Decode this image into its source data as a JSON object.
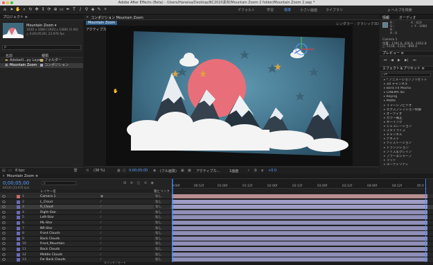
{
  "window": {
    "title": "Adobe After Effects (Beta) - /Users/Haneisa/Desktop/BC2020素材/Mountain Zoom 2 folder/Mountain Zoom 2.aep *"
  },
  "workspaces": [
    "デフォルト",
    "学習",
    "標準",
    "小さい画面",
    "ライブラリ"
  ],
  "workspace_active_index": 2,
  "project": {
    "header": "プロジェクト ≡",
    "comp_name": "Mountain Zoom ▾",
    "comp_info": [
      "1920 x 1080 (1920 x 1080) (1.00)",
      "△ 0;00;05;00, 23.976 fps"
    ],
    "search_placeholder": "ρ",
    "col_name": "名前",
    "col_type": "種類",
    "items": [
      {
        "name": "Adobeill...py Layers",
        "type": "フォルダー"
      },
      {
        "name": "Mountain Zoom",
        "type": "コンポジション"
      }
    ],
    "footer_bpc": "8 bpc"
  },
  "comp_panel": {
    "tab_label": "コンポジション Mountain Zoom",
    "subtab": "Mountain Zoom",
    "active_camera": "アクティブカメラ",
    "renderer": "レンダラー : クラシック3D",
    "footer": {
      "zoom": "(38 %)",
      "timecode": "0;00;05;00",
      "quality": "(フル画質)",
      "camera": "アクティブカ...",
      "views": "1画面",
      "exposure": "+0.0"
    }
  },
  "info_panel": {
    "tab_info": "情報",
    "tab_audio": "オーディオ",
    "values": [
      "R :",
      "G :",
      "B :",
      "A : 0",
      "X : 423",
      "+ Y : 1084"
    ],
    "lines": [
      "Camera 1",
      "位置：1291.6, 426.6, -1652.8",
      "△ -1156, -1122, -894.0"
    ]
  },
  "preview_panel": {
    "title": "プレビュー ≡"
  },
  "effects_panel": {
    "title": "エフェクト＆プリセット ≡",
    "search_placeholder": "ρ▾",
    "items": [
      "* アニメーションプリセット",
      "3D チャンネル",
      "Boris FX Mocha",
      "CINEMA 4D",
      "Keying",
      "Matte",
      "イマーシブビデオ",
      "エクスプレッション制御",
      "オーディオ",
      "カラー補正",
      "キーイング",
      "シミュレーション",
      "スタイライズ",
      "チャンネル",
      "テキスト",
      "ディストーション",
      "トランジション",
      "ノイズ＆グレイン",
      "ブラー＆シャープ",
      "マット",
      "ユーティリティ"
    ]
  },
  "timeline": {
    "tab": "Mountain Zoom ≡",
    "timecode": "0;00;05;00",
    "timecode_sub": "00120 (23.976 fps)",
    "col_layer_name": "レイヤー名",
    "col_parent": "親とリンク",
    "ruler": [
      "0:00f",
      "00:12f",
      "01:00f",
      "01:12f",
      "02:00f",
      "02:12f",
      "03:00f",
      "03:12f",
      "04:00f",
      "04:12f",
      "05:0"
    ],
    "footer": "スイッチ / モード",
    "parent_value": "なし",
    "layers": [
      {
        "num": "1",
        "name": "Camera 1",
        "color": "#c86a6a",
        "bar": "#b88f8f"
      },
      {
        "num": "2",
        "name": "L_Cloud",
        "color": "#6a6ab8",
        "bar": "#9c9cc4"
      },
      {
        "num": "3",
        "name": "R_Cloud",
        "color": "#6a6ab8",
        "bar": "#9c9cc4"
      },
      {
        "num": "4",
        "name": "Right-Star",
        "color": "#6a6ab8",
        "bar": "#8e8eb6"
      },
      {
        "num": "5",
        "name": "Left-Star",
        "color": "#6a6ab8",
        "bar": "#8e8eb6"
      },
      {
        "num": "6",
        "name": "ML-Star",
        "color": "#6a6ab8",
        "bar": "#8e8eb6"
      },
      {
        "num": "7",
        "name": "NR-Star",
        "color": "#6a6ab8",
        "bar": "#8e8eb6"
      },
      {
        "num": "8",
        "name": "Front Clouds",
        "color": "#6a6ab8",
        "bar": "#8e8eb6"
      },
      {
        "num": "9",
        "name": "Back Clouds",
        "color": "#6a6ab8",
        "bar": "#8e8eb6"
      },
      {
        "num": "10",
        "name": "Front_Mountain",
        "color": "#6a6ab8",
        "bar": "#8e8eb6"
      },
      {
        "num": "11",
        "name": "Back Clouds",
        "color": "#6a6ab8",
        "bar": "#8e8eb6"
      },
      {
        "num": "12",
        "name": "Middle Clouds",
        "color": "#6a6ab8",
        "bar": "#8e8eb6"
      },
      {
        "num": "13",
        "name": "Far Back Clouds",
        "color": "#6a6ab8",
        "bar": "#8e8eb6"
      }
    ]
  }
}
